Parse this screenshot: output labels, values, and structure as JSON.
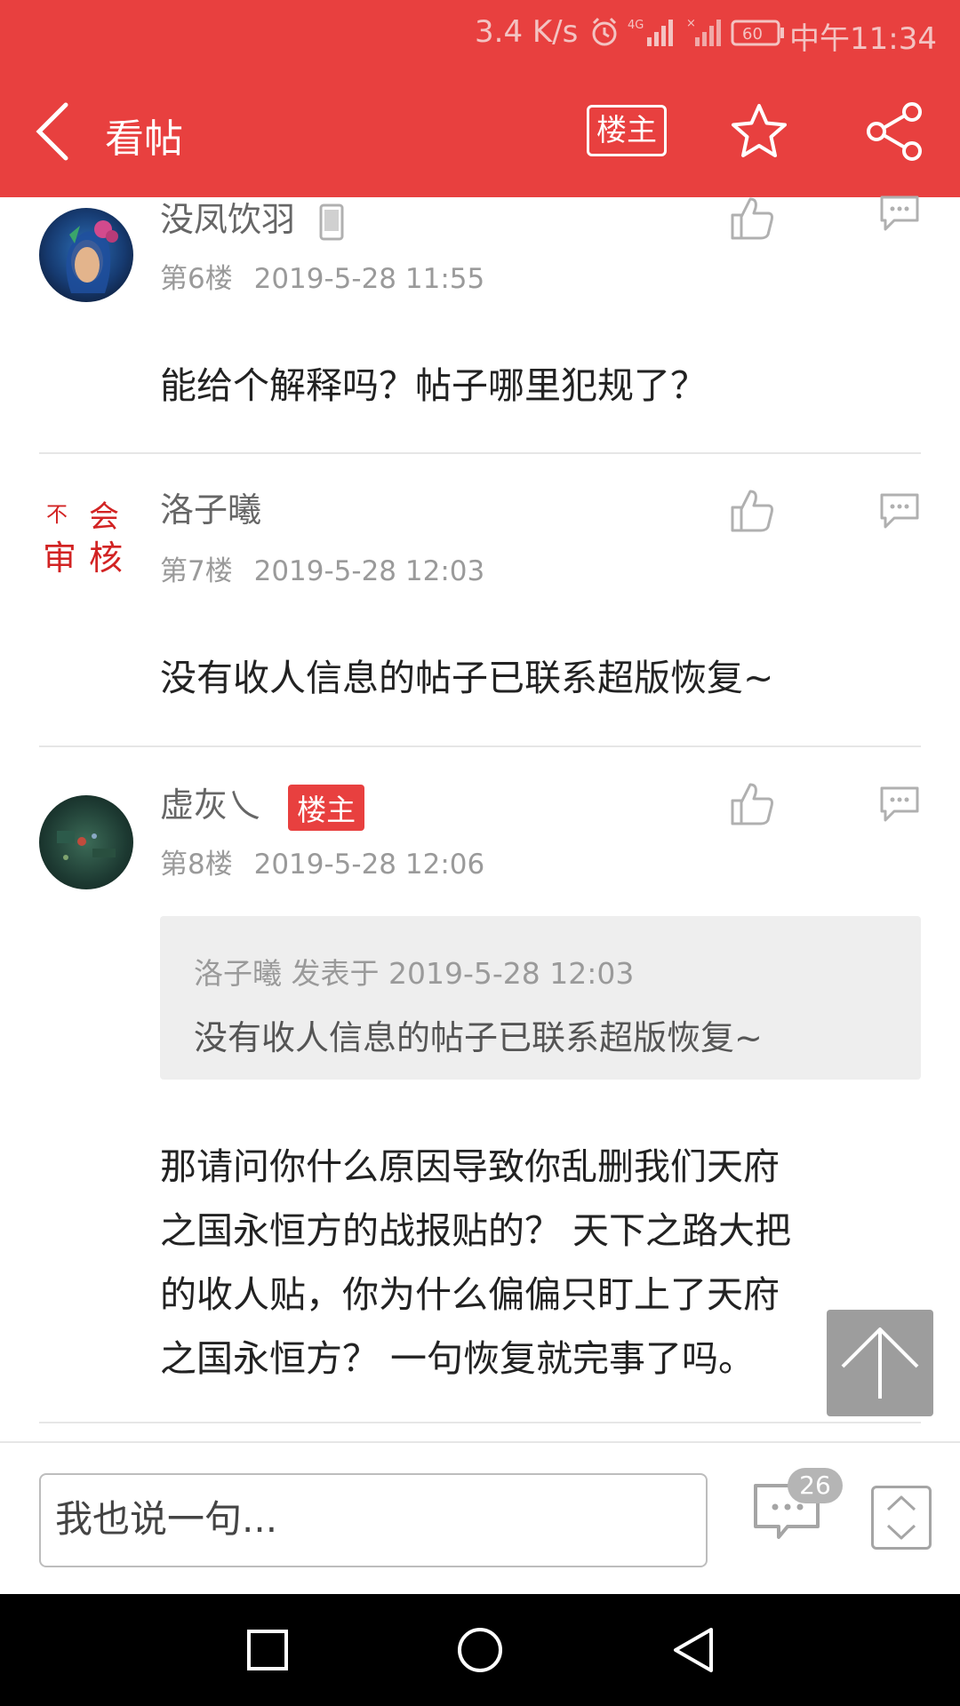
{
  "status_bar": {
    "speed": "3.4 K/s",
    "battery": "60",
    "time": "中午11:34"
  },
  "header": {
    "title": "看帖",
    "op_only_label": "楼主"
  },
  "posts": [
    {
      "username": "没凤饮羽",
      "floor": "第6楼",
      "date": "2019-5-28 11:55",
      "content": "能给个解释吗？帖子哪里犯规了？"
    },
    {
      "username": "洛子曦",
      "floor": "第7楼",
      "date": "2019-5-28 12:03",
      "avatar_text": [
        "不",
        "会",
        "审",
        "核"
      ],
      "content": "没有收人信息的帖子已联系超版恢复~"
    },
    {
      "username": "虚灰乀",
      "badge": "楼主",
      "floor": "第8楼",
      "date": "2019-5-28 12:06",
      "quote": {
        "meta": "洛子曦 发表于 2019-5-28 12:03",
        "text": "没有收人信息的帖子已联系超版恢复~"
      },
      "content_lines": [
        "那请问你什么原因导致你乱删我们天府",
        "之国永恒方的战报贴的？  天下之路大把",
        "的收人贴，你为什么偏偏只盯上了天府",
        "之国永恒方？   一句恢复就完事了吗。"
      ]
    }
  ],
  "bottom_bar": {
    "input_placeholder": "我也说一句...",
    "comment_count": "26"
  },
  "colors": {
    "brand_red": "#e8403f",
    "divider": "#e6e6e6"
  }
}
